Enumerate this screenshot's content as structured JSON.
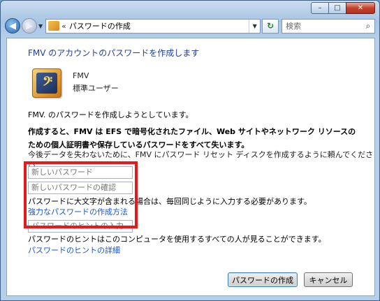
{
  "window": {
    "caption": {
      "minimize": "–",
      "maximize": "□",
      "close": "✕"
    }
  },
  "nav": {
    "back_glyph": "◀",
    "forward_glyph": "▶",
    "drop_glyph": "▼",
    "address_prefix": "«",
    "address_text": "パスワードの作成",
    "refresh_glyph": "↻",
    "search_placeholder": "検索",
    "search_icon_glyph": "⌕"
  },
  "content": {
    "heading": "FMV のアカウントのパスワードを作成します",
    "avatar_glyph": "𝄢",
    "user_name": "FMV",
    "user_type": "標準ユーザー",
    "p1": "FMV. のパスワードを作成しようとしています。",
    "p2": "作成すると、FMV は EFS で暗号化されたファイル、Web サイトやネットワーク リソースのための個人証明書や保存しているパスワードをすべて失います。",
    "p3": "今後データを失わないために、FMV にパスワード リセット ディスクを作成するように頼んでください。",
    "new_password_placeholder": "新しいパスワード",
    "confirm_password_placeholder": "新しいパスワードの確認",
    "case_note": "パスワードに大文字が含まれる場合は、毎回同じように入力する必要があります。",
    "strong_password_link": "強力なパスワードの作成方法",
    "hint_placeholder": "パスワードのヒントの入力",
    "hint_note": "パスワードのヒントはこのコンピュータを使用するすべての人が見ることができます。",
    "hint_details_link": "パスワードのヒントの詳細",
    "create_button": "パスワードの作成",
    "cancel_button": "キャンセル"
  },
  "colors": {
    "link": "#1d55c9",
    "heading": "#1e3e9c",
    "highlight_border": "#e8191c"
  }
}
